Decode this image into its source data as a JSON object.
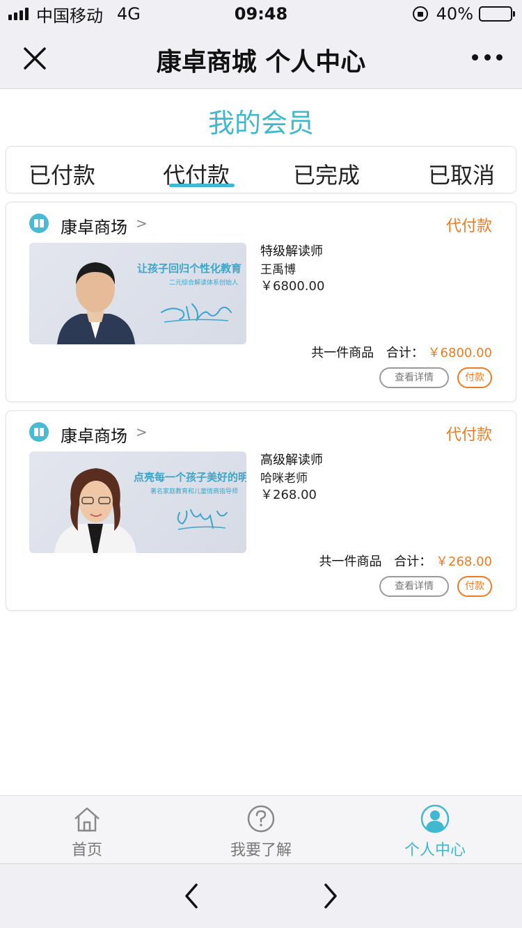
{
  "status_bar": {
    "carrier": "中国移动",
    "network": "4G",
    "time": "09:48",
    "battery": "40%",
    "battery_level": 0.4
  },
  "nav": {
    "title": "康卓商城 个人中心"
  },
  "page": {
    "title": "我的会员"
  },
  "tabs": [
    {
      "label": "已付款"
    },
    {
      "label": "代付款",
      "active": true
    },
    {
      "label": "已完成"
    },
    {
      "label": "已取消"
    }
  ],
  "orders": [
    {
      "store": "康卓商场",
      "store_arrow": ">",
      "status": "代付款",
      "thumb_slogan": "让孩子回归个性化教育",
      "thumb_sub": "二元综合解读体系创始人",
      "product_name": "特级解读师",
      "teacher": "王禹博",
      "price": "￥6800.00",
      "count_label": "共一件商品",
      "total_label": "合计：",
      "total": "￥6800.00",
      "detail_label": "查看详情",
      "pay_label": "付款"
    },
    {
      "store": "康卓商场",
      "store_arrow": ">",
      "status": "代付款",
      "thumb_slogan": "点亮每一个孩子美好的明天",
      "thumb_sub": "著名家庭教育和儿童情商指导师",
      "product_name": "高级解读师",
      "teacher": "哈咪老师",
      "price": "￥268.00",
      "count_label": "共一件商品",
      "total_label": "合计：",
      "total": "￥268.00",
      "detail_label": "查看详情",
      "pay_label": "付款"
    }
  ],
  "bottom_tabs": [
    {
      "label": "首页",
      "icon": "home-icon"
    },
    {
      "label": "我要了解",
      "icon": "question-icon"
    },
    {
      "label": "个人中心",
      "icon": "user-icon",
      "active": true
    }
  ],
  "colors": {
    "accent": "#3fb8d0",
    "orange": "#f07a1e"
  }
}
